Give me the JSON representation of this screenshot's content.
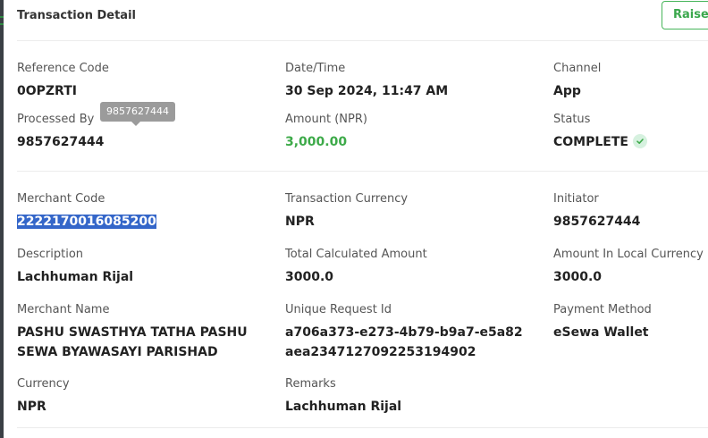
{
  "header": {
    "title": "Transaction Detail",
    "raise_label": "Raise Issue"
  },
  "fields": {
    "reference_code": {
      "label": "Reference Code",
      "value": "0OPZRTI"
    },
    "datetime": {
      "label": "Date/Time",
      "value": "30 Sep 2024, 11:47 AM"
    },
    "channel": {
      "label": "Channel",
      "value": "App"
    },
    "processed_by": {
      "label": "Processed By",
      "value": "9857627444"
    },
    "amount": {
      "label": "Amount (NPR)",
      "value": "3,000.00"
    },
    "status": {
      "label": "Status",
      "value": "COMPLETE"
    },
    "merchant_code": {
      "label": "Merchant Code",
      "value": "2222170016085200"
    },
    "transaction_currency": {
      "label": "Transaction Currency",
      "value": "NPR"
    },
    "initiator": {
      "label": "Initiator",
      "value": "9857627444"
    },
    "description": {
      "label": "Description",
      "value": "Lachhuman Rijal"
    },
    "total_calculated_amount": {
      "label": "Total Calculated Amount",
      "value": "3000.0"
    },
    "amount_local_currency": {
      "label": "Amount In Local Currency",
      "value": "3000.0"
    },
    "merchant_name": {
      "label": "Merchant Name",
      "value": "PASHU SWASTHYA TATHA PASHU SEWA BYAWASAYI PARISHAD"
    },
    "unique_request_id": {
      "label": "Unique Request Id",
      "value": "a706a373-e273-4b79-b9a7-e5a82aea2347127092253194902"
    },
    "payment_method": {
      "label": "Payment Method",
      "value": "eSewa Wallet"
    },
    "currency": {
      "label": "Currency",
      "value": "NPR"
    },
    "remarks": {
      "label": "Remarks",
      "value": "Lachhuman Rijal"
    }
  },
  "tooltip": {
    "text": "9857627444"
  },
  "colors": {
    "accent_green": "#3daa49",
    "selection_blue": "#3466c9",
    "tooltip_gray": "#9b9b9b"
  },
  "icons": {
    "status": "check-circle-icon"
  }
}
